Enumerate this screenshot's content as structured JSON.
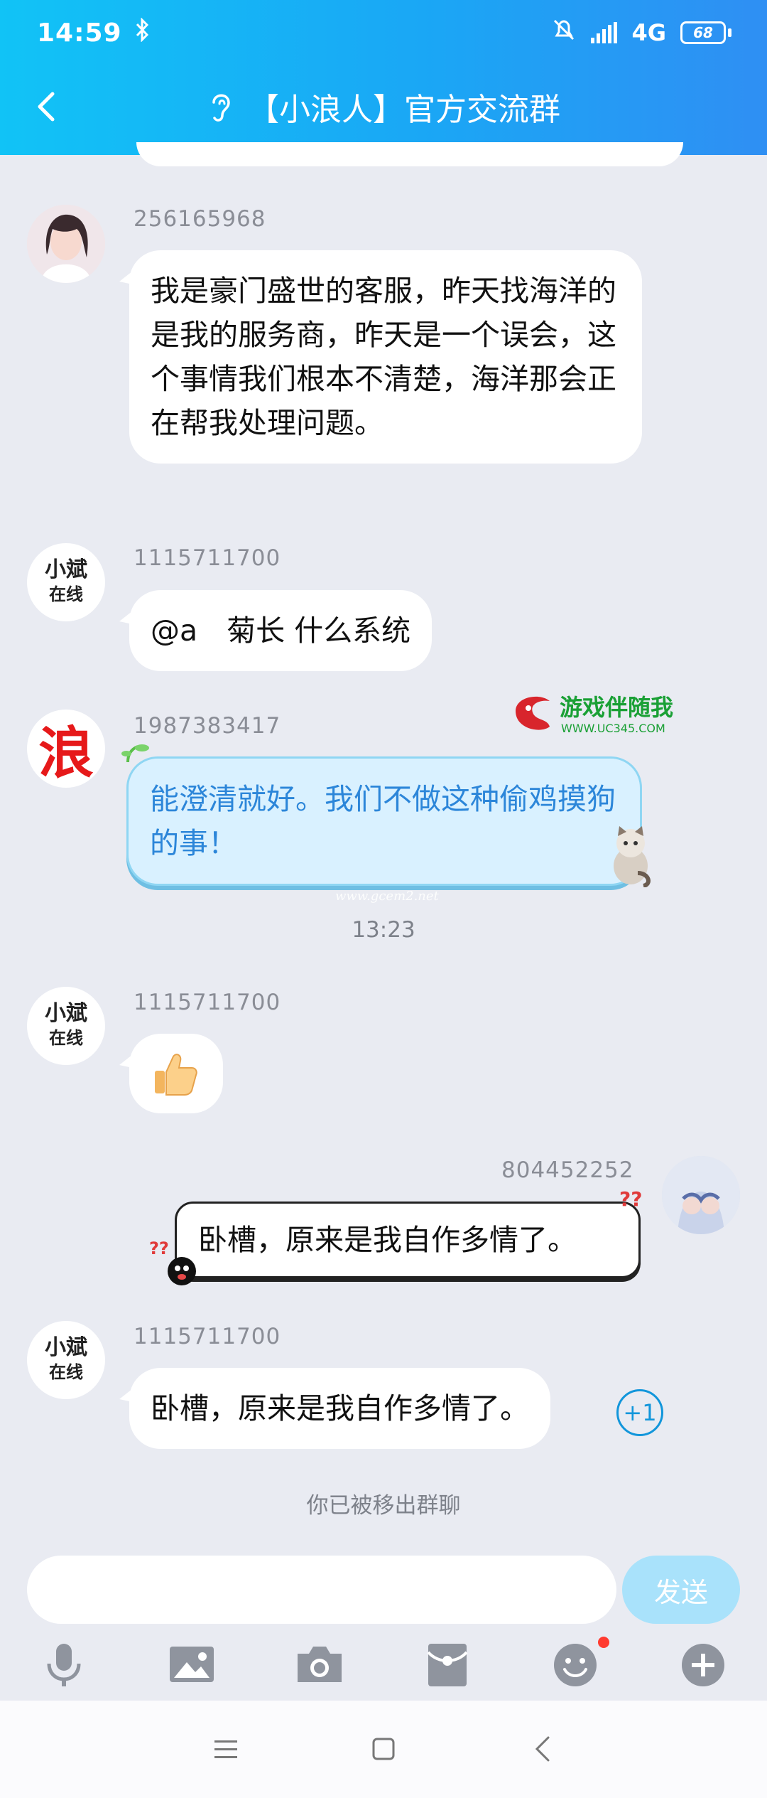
{
  "status_bar": {
    "time": "14:59",
    "network": "4G",
    "battery": "68"
  },
  "header": {
    "title": "【小浪人】官方交流群"
  },
  "messages": [
    {
      "sender": "256165968",
      "text": "我是豪门盛世的客服，昨天找海洋的是我的服务商，昨天是一个误会，这个事情我们根本不清楚，海洋那会正在帮我处理问题。"
    },
    {
      "sender": "1115711700",
      "text": "@a　菊长 什么系统"
    },
    {
      "sender": "1987383417",
      "text": "能澄清就好。我们不做这种偷鸡摸狗的事！"
    },
    {
      "sender": "1115711700",
      "text": "👍"
    },
    {
      "sender": "804452252",
      "text": "卧槽，原来是我自作多情了。"
    },
    {
      "sender": "1115711700",
      "text": "卧槽，原来是我自作多情了。"
    }
  ],
  "avatars": {
    "xiaobin_line1": "小斌",
    "xiaobin_line2": "在线",
    "lang": "浪"
  },
  "timestamp": "13:23",
  "plus_one": "+1",
  "system_notice": "你已被移出群聊",
  "input": {
    "placeholder": "",
    "send_label": "发送"
  },
  "watermarks": {
    "logo_text": "游戏伴随我",
    "logo_url": "WWW.UC345.COM",
    "site": "www.gcem2.net"
  },
  "colors": {
    "header_start": "#11c3f6",
    "header_end": "#2f8ff3",
    "accent": "#1296db",
    "send_disabled": "#a9e2fb"
  }
}
